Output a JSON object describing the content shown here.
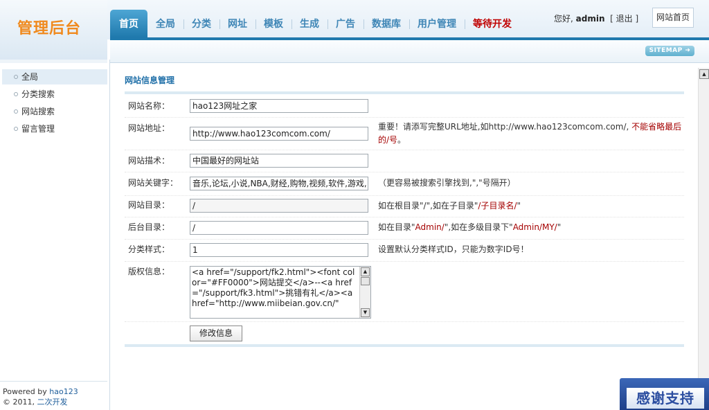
{
  "logo": {
    "text": "管理后台"
  },
  "topnav": [
    {
      "label": "首页",
      "active": true
    },
    {
      "label": "全局"
    },
    {
      "label": "分类"
    },
    {
      "label": "网址"
    },
    {
      "label": "模板"
    },
    {
      "label": "生成"
    },
    {
      "label": "广告"
    },
    {
      "label": "数据库"
    },
    {
      "label": "用户管理"
    },
    {
      "label": "等待开发",
      "highlight": true
    }
  ],
  "user": {
    "greeting": "您好,",
    "name": "admin",
    "logout_open": "[",
    "logout": "退出",
    "logout_close": "]",
    "home_button": "网站首页"
  },
  "subbar": {
    "sitemap": "SITEMAP ➜"
  },
  "sidebar": {
    "items": [
      {
        "label": "全局",
        "active": true
      },
      {
        "label": "分类搜索"
      },
      {
        "label": "网站搜索"
      },
      {
        "label": "留言管理"
      }
    ],
    "footer": {
      "powered_prefix": "Powered by ",
      "powered_name": "hao123",
      "copyright_prefix": "© 2011, ",
      "copyright_name": "二次开发"
    }
  },
  "main": {
    "title": "网站信息管理",
    "fields": [
      {
        "label": "网站名称：",
        "value": "hao123网址之家"
      },
      {
        "label": "网站地址：",
        "value": "http://www.hao123comcom.com/",
        "hint_prefix": "重要！请添写完整URL地址,如http://www.hao123comcom.com/, ",
        "hint_red": "不能省略最后的/号",
        "hint_suffix": "。"
      },
      {
        "label": "网站描术：",
        "value": "中国最好的网址站"
      },
      {
        "label": "网站关键字：",
        "value": "音乐,论坛,小说,NBA,财经,购物,视频,软件,游戏,",
        "hint": "（更容易被搜索引擎找到,\",\"号隔开）"
      },
      {
        "label": "网站目录：",
        "value": "/",
        "hint_prefix": "如在根目录\"/\",如在子目录\"",
        "hint_red": "/子目录名/",
        "hint_suffix": "\""
      },
      {
        "label": "后台目录：",
        "value": "/",
        "hint_prefix": "如在目录\"",
        "hint_red": "Admin/",
        "hint_mid": "\",如在多级目录下\"",
        "hint_red2": "Admin/MY/",
        "hint_suffix": "\""
      },
      {
        "label": "分类样式：",
        "value": "1",
        "hint": "设置默认分类样式ID，只能为数字ID号！"
      },
      {
        "label": "版权信息：",
        "value": "<a href=\"/support/fk2.html\"><font color=\"#FF0000\">网站提交</a>--<a href=\"/support/fk3.html\">挑错有礼</a><a href=\"http://www.miibeian.gov.cn/\""
      }
    ],
    "submit": "修改信息"
  },
  "colors": {
    "brand_orange": "#f08a1e",
    "nav_blue": "#1f79ad",
    "hint_red": "#a40000",
    "title_blue": "#1f6fa8"
  },
  "badge": {
    "text": "感谢支持"
  }
}
